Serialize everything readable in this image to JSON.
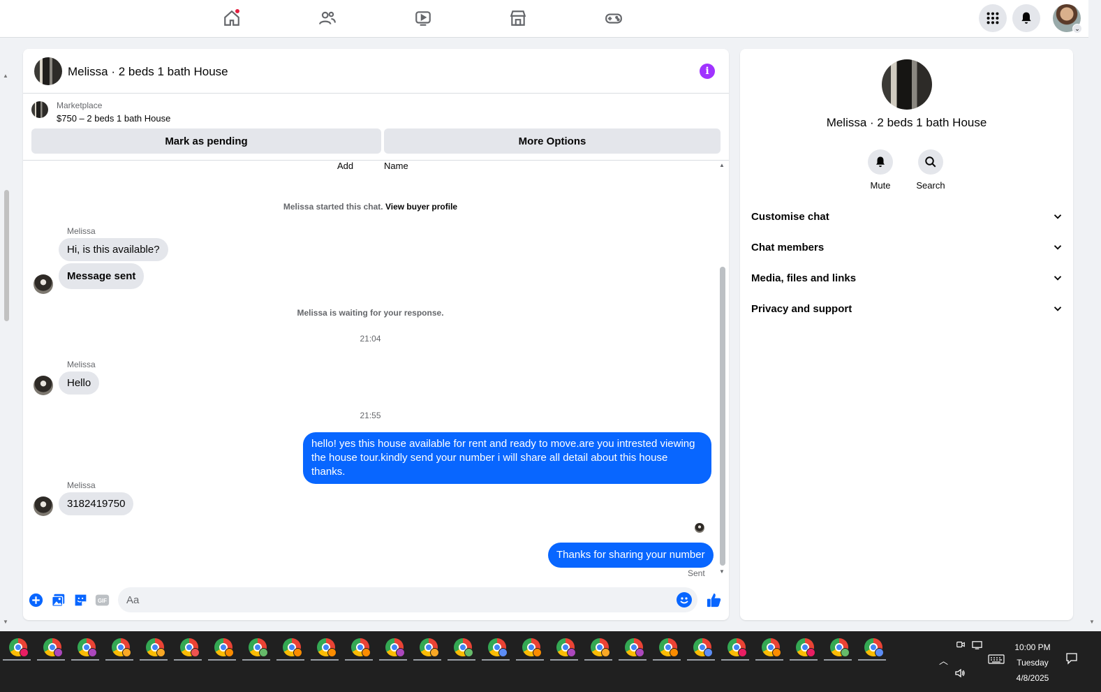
{
  "topnav": {
    "icons": [
      "home-icon",
      "friends-icon",
      "video-icon",
      "marketplace-icon",
      "gaming-icon",
      "menu-grid-icon",
      "bell-icon",
      "profile-avatar"
    ]
  },
  "chat": {
    "title": "Melissa · 2 beds 1 bath House",
    "marketplace_label": "Marketplace",
    "listing": "$750 – 2 beds 1 bath House",
    "pending_button": "Mark as pending",
    "options_button": "More Options",
    "top_add": "Add",
    "top_name": "Name",
    "started_text": "Melissa started this chat.",
    "buyer_profile_link": "View buyer profile",
    "waiting_text": "Melissa is waiting for your response.",
    "time1": "21:04",
    "time2": "21:55",
    "messages": [
      {
        "sender": "Melissa",
        "text": "Hi, is this available?"
      },
      {
        "text": "Message sent"
      },
      {
        "sender": "Melissa",
        "text": "Hello"
      },
      {
        "outgoing": true,
        "text": "hello! yes this house available for rent and ready to move.are you intrested viewing the house tour.kindly send your number i will share all detail about this house thanks."
      },
      {
        "sender": "Melissa",
        "text": "3182419750"
      },
      {
        "outgoing": true,
        "text": "Thanks for sharing your number"
      }
    ],
    "status": "Sent",
    "composer_placeholder": "Aa"
  },
  "info_panel": {
    "title": "Melissa · 2 beds 1 bath House",
    "mute_label": "Mute",
    "search_label": "Search",
    "sections": [
      "Customise chat",
      "Chat members",
      "Media, files and links",
      "Privacy and support"
    ]
  },
  "taskbar": {
    "time": "10:00 PM",
    "day": "Tuesday",
    "date": "4/8/2025"
  },
  "colors": {
    "accent": "#0866ff",
    "info_purple": "#a033ff",
    "notification_red": "#e41e3f"
  }
}
